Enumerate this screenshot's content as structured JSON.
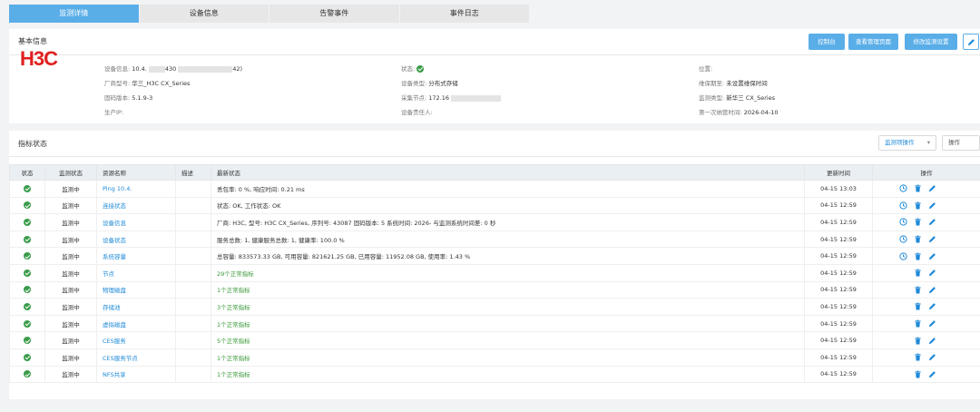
{
  "tabs": [
    "监测详情",
    "设备信息",
    "告警事件",
    "事件日志"
  ],
  "basic": {
    "title": "基本信息",
    "buttons": [
      "控制台",
      "查看管理页面",
      "修改监测设置"
    ],
    "logo": "H3C",
    "col1": [
      {
        "k": "设备信息:",
        "v": "10.4."
      },
      {
        "k": "厂商型号:",
        "v": "华三_H3C CX_Series"
      },
      {
        "k": "固码版本:",
        "v": "5.1.9-3"
      },
      {
        "k": "生产IP:",
        "v": ""
      }
    ],
    "col1_extra": [
      "430",
      "42)"
    ],
    "col2": [
      {
        "k": "状态:",
        "v": ""
      },
      {
        "k": "设备类型:",
        "v": "分布式存储"
      },
      {
        "k": "采集节点:",
        "v": "172.16"
      },
      {
        "k": "设备责任人:",
        "v": ""
      }
    ],
    "col3": [
      {
        "k": "位置:",
        "v": ""
      },
      {
        "k": "维保期至:",
        "v": "未设置维保时间"
      },
      {
        "k": "监测类型:",
        "v": "新华三 CX_Series"
      },
      {
        "k": "第一次纳管时间:",
        "v": "2026-04-10"
      }
    ]
  },
  "metrics": {
    "title": "指标状态",
    "monitor_op": "监测项操作",
    "op": "操作",
    "headers": [
      "状态",
      "监测状态",
      "资源名称",
      "描述",
      "最新状态",
      "更新时间",
      "操作"
    ],
    "rows": [
      {
        "monitor": "监测中",
        "name": "Ping 10.4.",
        "desc": "",
        "latest": "丢包率: 0 %, 响应时间: 0.21 ms",
        "time": "04-15 13:03",
        "clock": true,
        "green": false
      },
      {
        "monitor": "监测中",
        "name": "连接状态",
        "desc": "",
        "latest": "状态: OK, 工作状态: OK",
        "time": "04-15 12:59",
        "clock": true,
        "green": false
      },
      {
        "monitor": "监测中",
        "name": "设备信息",
        "desc": "",
        "latest": "厂商: H3C, 型号: H3C CX_Series, 序列号: 43087                固码版本: 5          系统时间: 2026-          与监测系统时间差: 0 秒",
        "time": "04-15 12:59",
        "clock": true,
        "green": false
      },
      {
        "monitor": "监测中",
        "name": "设备状态",
        "desc": "",
        "latest": "服务总数: 1, 健康服务总数: 1, 健康率: 100.0 %",
        "time": "04-15 12:59",
        "clock": true,
        "green": false
      },
      {
        "monitor": "监测中",
        "name": "系统容量",
        "desc": "",
        "latest": "总容量: 833573.33 GB, 可用容量: 821621.25 GB, 已用容量: 11952.08 GB, 使用率: 1.43 %",
        "time": "04-15 12:59",
        "clock": true,
        "green": false
      },
      {
        "monitor": "监测中",
        "name": "节点",
        "desc": "",
        "latest": "29个正常指标",
        "time": "04-15 12:59",
        "clock": false,
        "green": true
      },
      {
        "monitor": "监测中",
        "name": "物理磁盘",
        "desc": "",
        "latest": "1个正常指标",
        "time": "04-15 12:59",
        "clock": false,
        "green": true
      },
      {
        "monitor": "监测中",
        "name": "存储池",
        "desc": "",
        "latest": "3个正常指标",
        "time": "04-15 12:59",
        "clock": false,
        "green": true
      },
      {
        "monitor": "监测中",
        "name": "虚拟磁盘",
        "desc": "",
        "latest": "1个正常指标",
        "time": "04-15 12:59",
        "clock": false,
        "green": true
      },
      {
        "monitor": "监测中",
        "name": "CES服务",
        "desc": "",
        "latest": "5个正常指标",
        "time": "04-15 12:59",
        "clock": false,
        "green": true
      },
      {
        "monitor": "监测中",
        "name": "CES服务节点",
        "desc": "",
        "latest": "1个正常指标",
        "time": "04-15 12:59",
        "clock": false,
        "green": true
      },
      {
        "monitor": "监测中",
        "name": "NFS共享",
        "desc": "",
        "latest": "1个正常指标",
        "time": "04-15 12:59",
        "clock": false,
        "green": true
      }
    ]
  },
  "colors": {
    "accent": "#5aaee8",
    "link": "#1f8ad8",
    "ok": "#3a9c4a",
    "logo": "#e02020"
  }
}
